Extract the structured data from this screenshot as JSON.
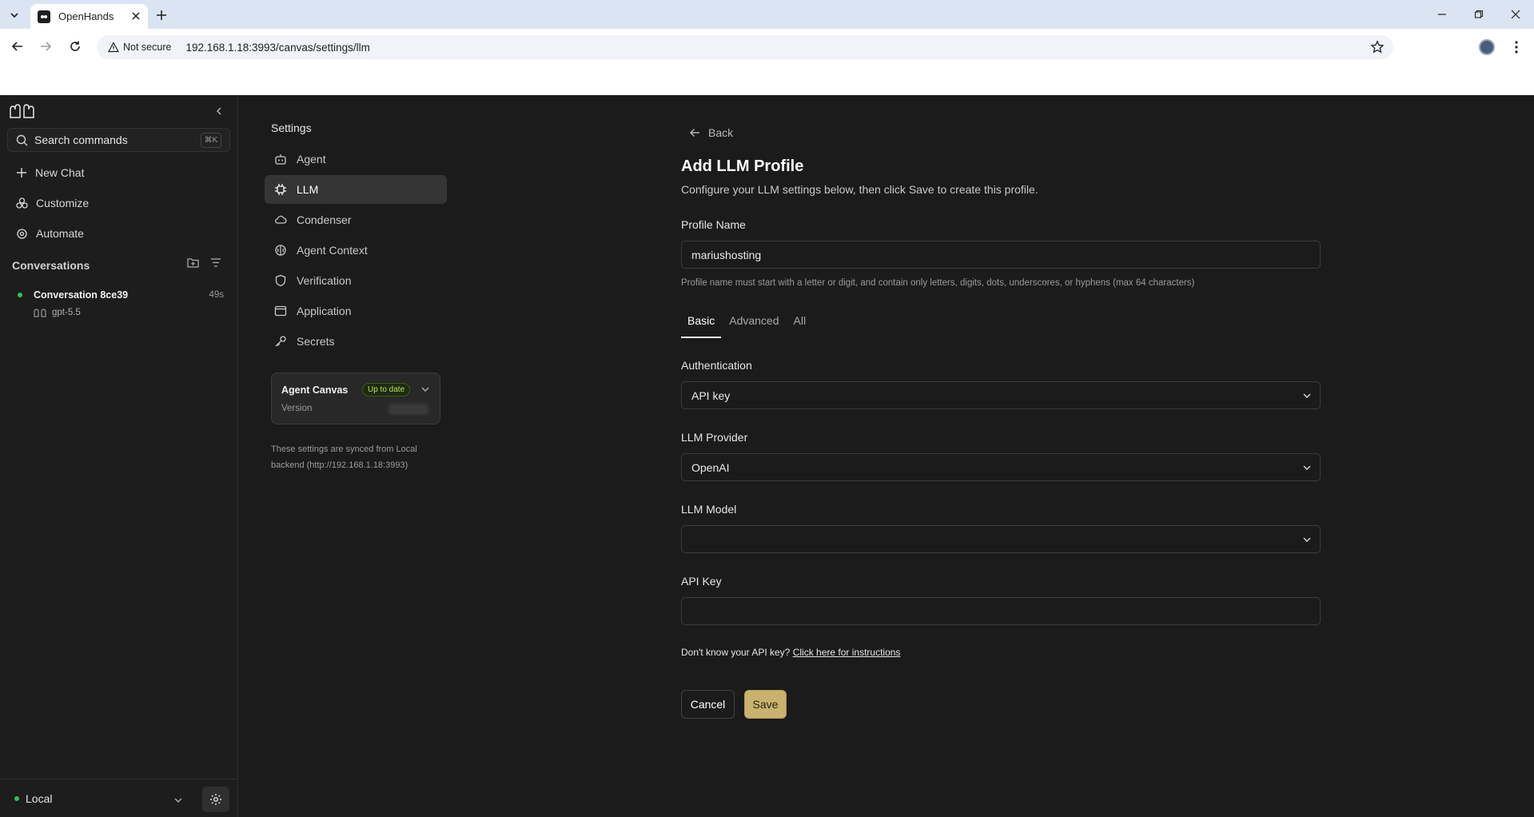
{
  "browser": {
    "tab_title": "OpenHands",
    "security_label": "Not secure",
    "url": "192.168.1.18:3993/canvas/settings/llm"
  },
  "sidebar": {
    "search_placeholder": "Search commands",
    "search_shortcut": "⌘K",
    "nav": [
      {
        "label": "New Chat",
        "icon": "plus-icon"
      },
      {
        "label": "Customize",
        "icon": "palette-icon"
      },
      {
        "label": "Automate",
        "icon": "gear-cog-icon"
      }
    ],
    "conversations_heading": "Conversations",
    "conversation": {
      "title": "Conversation 8ce39",
      "time": "49s",
      "model": "gpt-5.5",
      "status_color": "#2fc45a"
    },
    "backend": {
      "label": "Local",
      "status_color": "#2fc45a"
    }
  },
  "settings_nav": {
    "title": "Settings",
    "items": [
      {
        "label": "Agent",
        "icon": "robot-icon"
      },
      {
        "label": "LLM",
        "icon": "chip-icon",
        "active": true
      },
      {
        "label": "Condenser",
        "icon": "cloud-icon"
      },
      {
        "label": "Agent Context",
        "icon": "brain-icon"
      },
      {
        "label": "Verification",
        "icon": "shield-icon"
      },
      {
        "label": "Application",
        "icon": "window-icon"
      },
      {
        "label": "Secrets",
        "icon": "key-icon"
      }
    ],
    "card": {
      "title": "Agent Canvas",
      "badge": "Up to date",
      "version_label": "Version"
    },
    "sync_note": "These settings are synced from Local backend (http://192.168.1.18:3993)"
  },
  "form": {
    "back_label": "Back",
    "title": "Add LLM Profile",
    "subtitle": "Configure your LLM settings below, then click Save to create this profile.",
    "profile_name_label": "Profile Name",
    "profile_name_value": "mariushosting",
    "profile_name_hint": "Profile name must start with a letter or digit, and contain only letters, digits, dots, underscores, or hyphens (max 64 characters)",
    "tabs": [
      "Basic",
      "Advanced",
      "All"
    ],
    "auth_label": "Authentication",
    "auth_value": "API key",
    "provider_label": "LLM Provider",
    "provider_value": "OpenAI",
    "model_label": "LLM Model",
    "model_value": "",
    "api_key_label": "API Key",
    "api_key_value": "",
    "help_text": "Don't know your API key?",
    "help_link": "Click here for instructions",
    "cancel_label": "Cancel",
    "save_label": "Save",
    "accent": "#c9b26e"
  }
}
